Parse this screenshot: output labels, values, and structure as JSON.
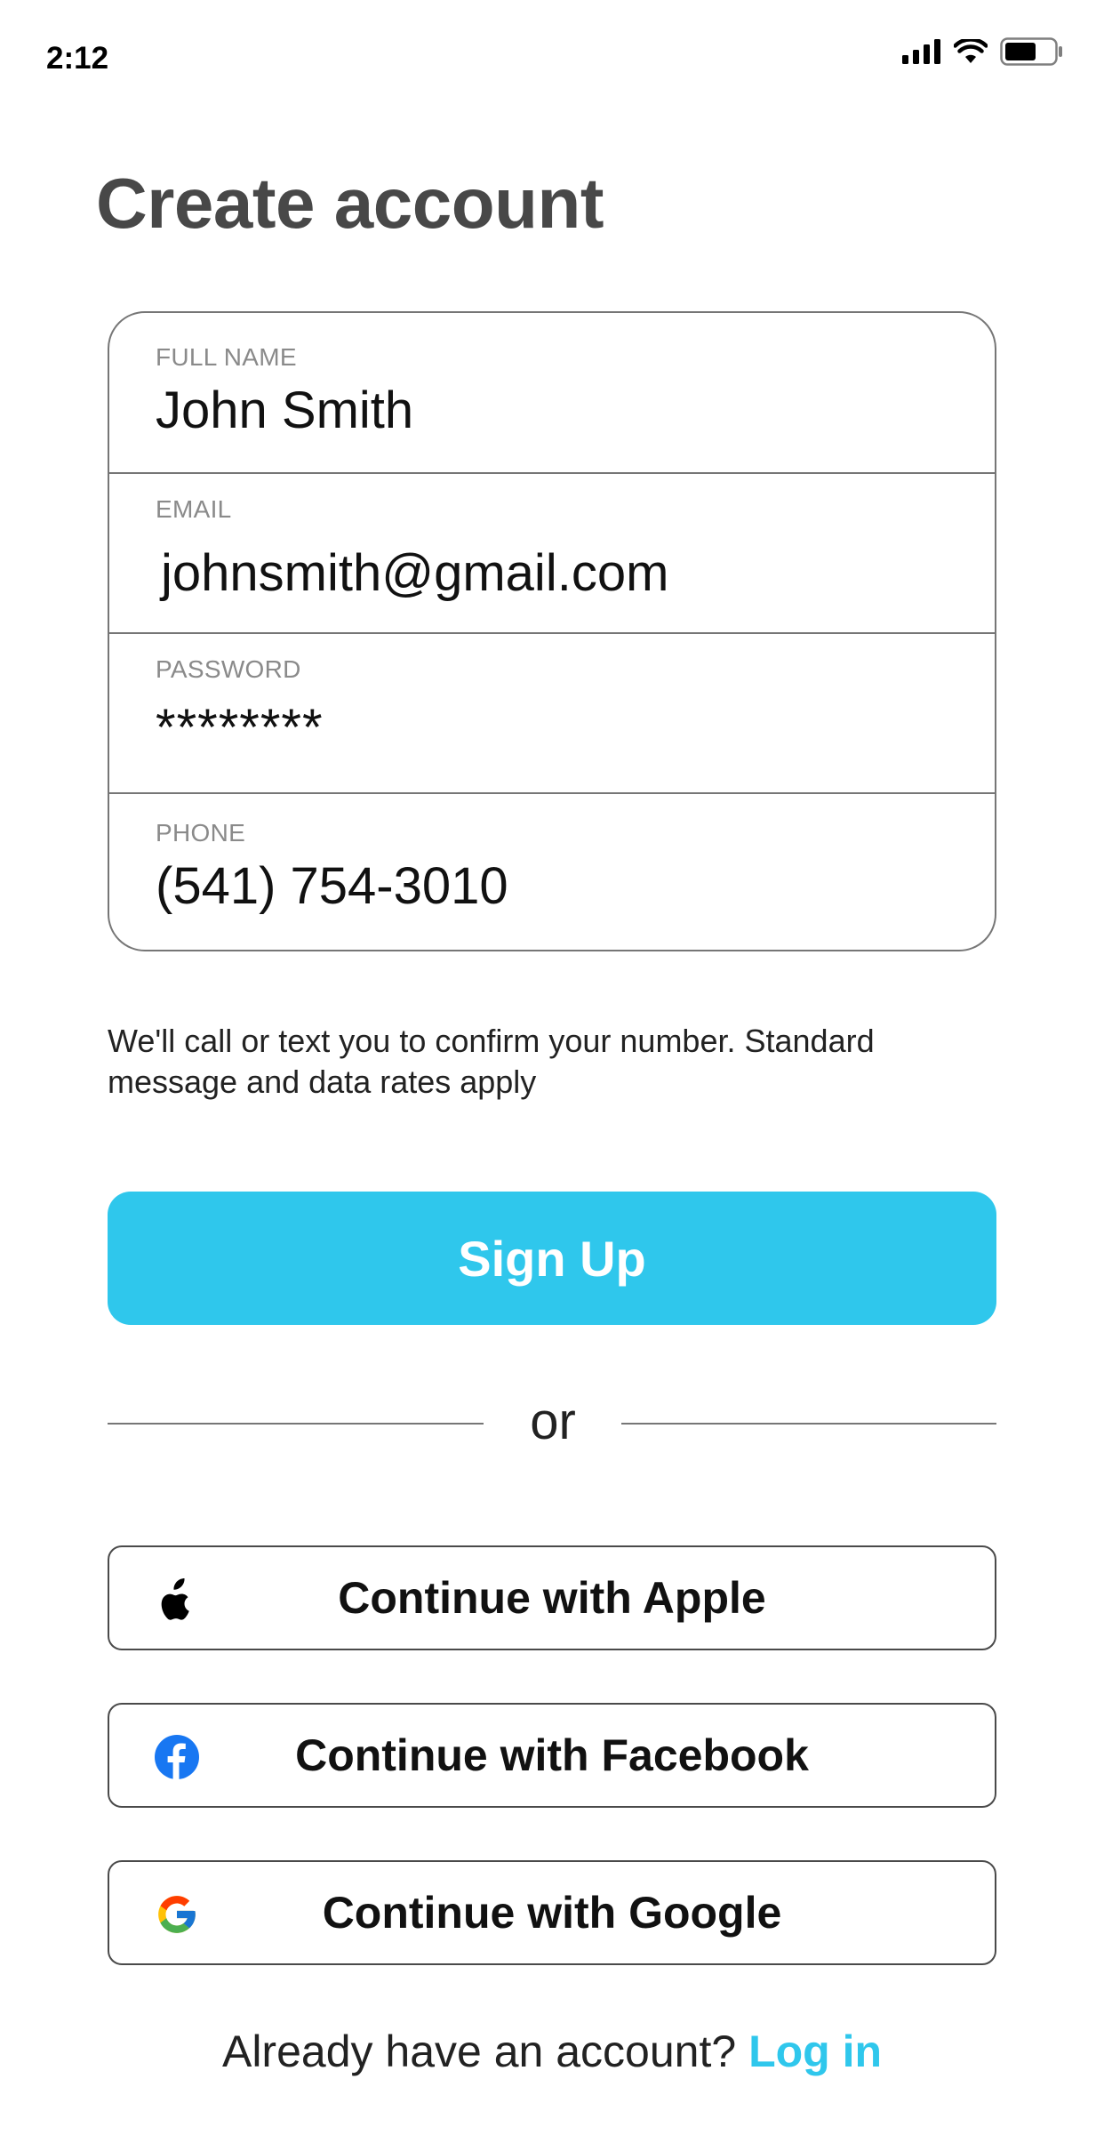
{
  "status_bar": {
    "time": "2:12"
  },
  "title": "Create account",
  "form": {
    "full_name": {
      "label": "FULL NAME",
      "value": "John Smith"
    },
    "email": {
      "label": "EMAIL",
      "value": "johnsmith@gmail.com"
    },
    "password": {
      "label": "PASSWORD",
      "value": "********"
    },
    "phone": {
      "label": "PHONE",
      "value": "(541) 754-3010"
    }
  },
  "helper_text": "We'll call or text you to confirm your number. Standard message and data rates apply",
  "signup_button": "Sign Up",
  "divider_text": "or",
  "social": {
    "apple": "Continue with Apple",
    "facebook": "Continue with Facebook",
    "google": "Continue with Google"
  },
  "footer": {
    "prompt": "Already have an account?",
    "login": "Log in"
  },
  "colors": {
    "accent": "#2fc7ec",
    "title": "#484848",
    "border": "#767676",
    "facebook": "#1877f2"
  },
  "icons": [
    "signal-icon",
    "wifi-icon",
    "battery-icon",
    "apple-icon",
    "facebook-icon",
    "google-icon"
  ]
}
